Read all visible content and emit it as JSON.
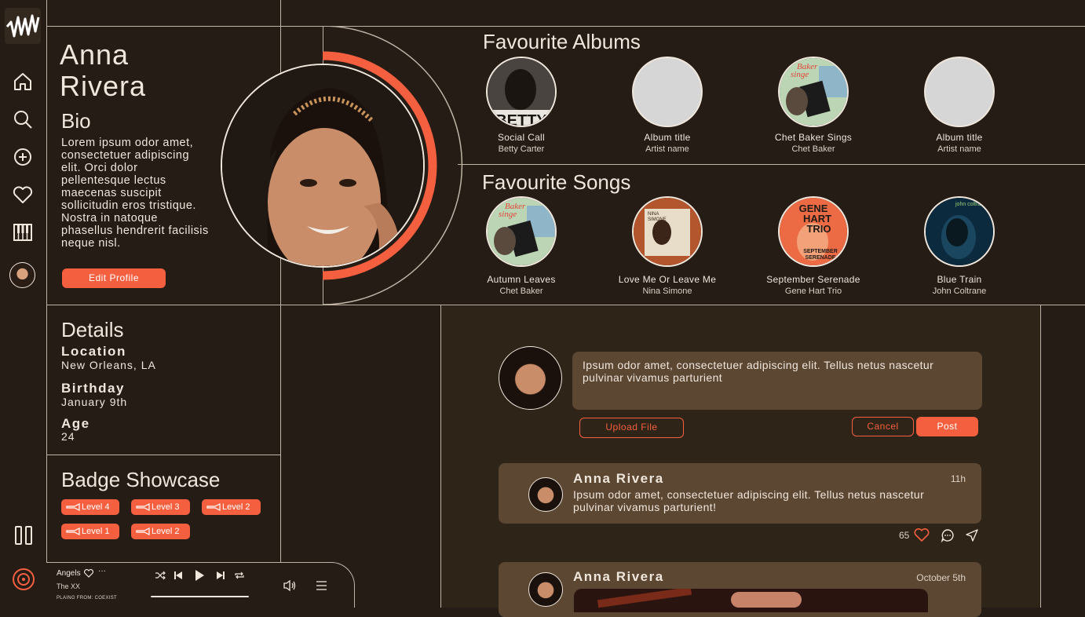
{
  "profile": {
    "first_name": "Anna",
    "last_name": "Rivera",
    "bio_title": "Bio",
    "bio_text": "Lorem ipsum odor amet, consectetuer adipiscing elit. Orci dolor pellentesque lectus maecenas suscipit sollicitudin eros tristique. Nostra in natoque phasellus hendrerit facilisis neque nisl.",
    "edit_label": "Edit Profile"
  },
  "details": {
    "title": "Details",
    "location_label": "Location",
    "location": "New Orleans, LA",
    "birthday_label": "Birthday",
    "birthday": "January 9th",
    "age_label": "Age",
    "age": "24"
  },
  "badges": {
    "title": "Badge Showcase",
    "items": [
      "Level 4",
      "Level 3",
      "Level 2",
      "Level 1",
      "Level 2"
    ]
  },
  "albums": {
    "title": "Favourite Albums",
    "items": [
      {
        "title": "Social Call",
        "artist": "Betty Carter"
      },
      {
        "title": "Album title",
        "artist": "Artist name"
      },
      {
        "title": "Chet Baker Sings",
        "artist": "Chet Baker"
      },
      {
        "title": "Album title",
        "artist": "Artist name"
      }
    ]
  },
  "songs": {
    "title": "Favourite Songs",
    "items": [
      {
        "title": "Autumn Leaves",
        "artist": "Chet Baker"
      },
      {
        "title": "Love Me Or Leave Me",
        "artist": "Nina Simone"
      },
      {
        "title": "September Serenade",
        "artist": "Gene Hart Trio"
      },
      {
        "title": "Blue Train",
        "artist": "John Coltrane"
      }
    ]
  },
  "composer": {
    "text": "Ipsum odor amet, consectetuer adipiscing elit. Tellus netus nascetur pulvinar vivamus parturient",
    "upload_label": "Upload File",
    "cancel_label": "Cancel",
    "post_label": "Post"
  },
  "posts": [
    {
      "author": "Anna Rivera",
      "time": "11h",
      "text": "Ipsum odor amet, consectetuer adipiscing elit. Tellus netus nascetur pulvinar vivamus parturient!",
      "likes": "65"
    },
    {
      "author": "Anna Rivera",
      "time": "October 5th"
    }
  ],
  "player": {
    "track": "Angels",
    "artist": "The XX",
    "source": "PLAING FROM: COEXIST",
    "progress": 0.0
  },
  "album_art": {
    "chet_a": "Baker",
    "chet_b": "singe",
    "betty": "BETTY",
    "nina_a": "NINA",
    "nina_b": "SIMONE",
    "gene_a": "GENE",
    "gene_b": "HART",
    "gene_c": "TRIO",
    "gene_d": "SEPTEMBER",
    "gene_e": "SERENADE",
    "coltrane": "john coltrane"
  },
  "colors": {
    "accent": "#f4603f",
    "bg": "#251c16",
    "card": "#5c4733",
    "text": "#efe6dc"
  }
}
